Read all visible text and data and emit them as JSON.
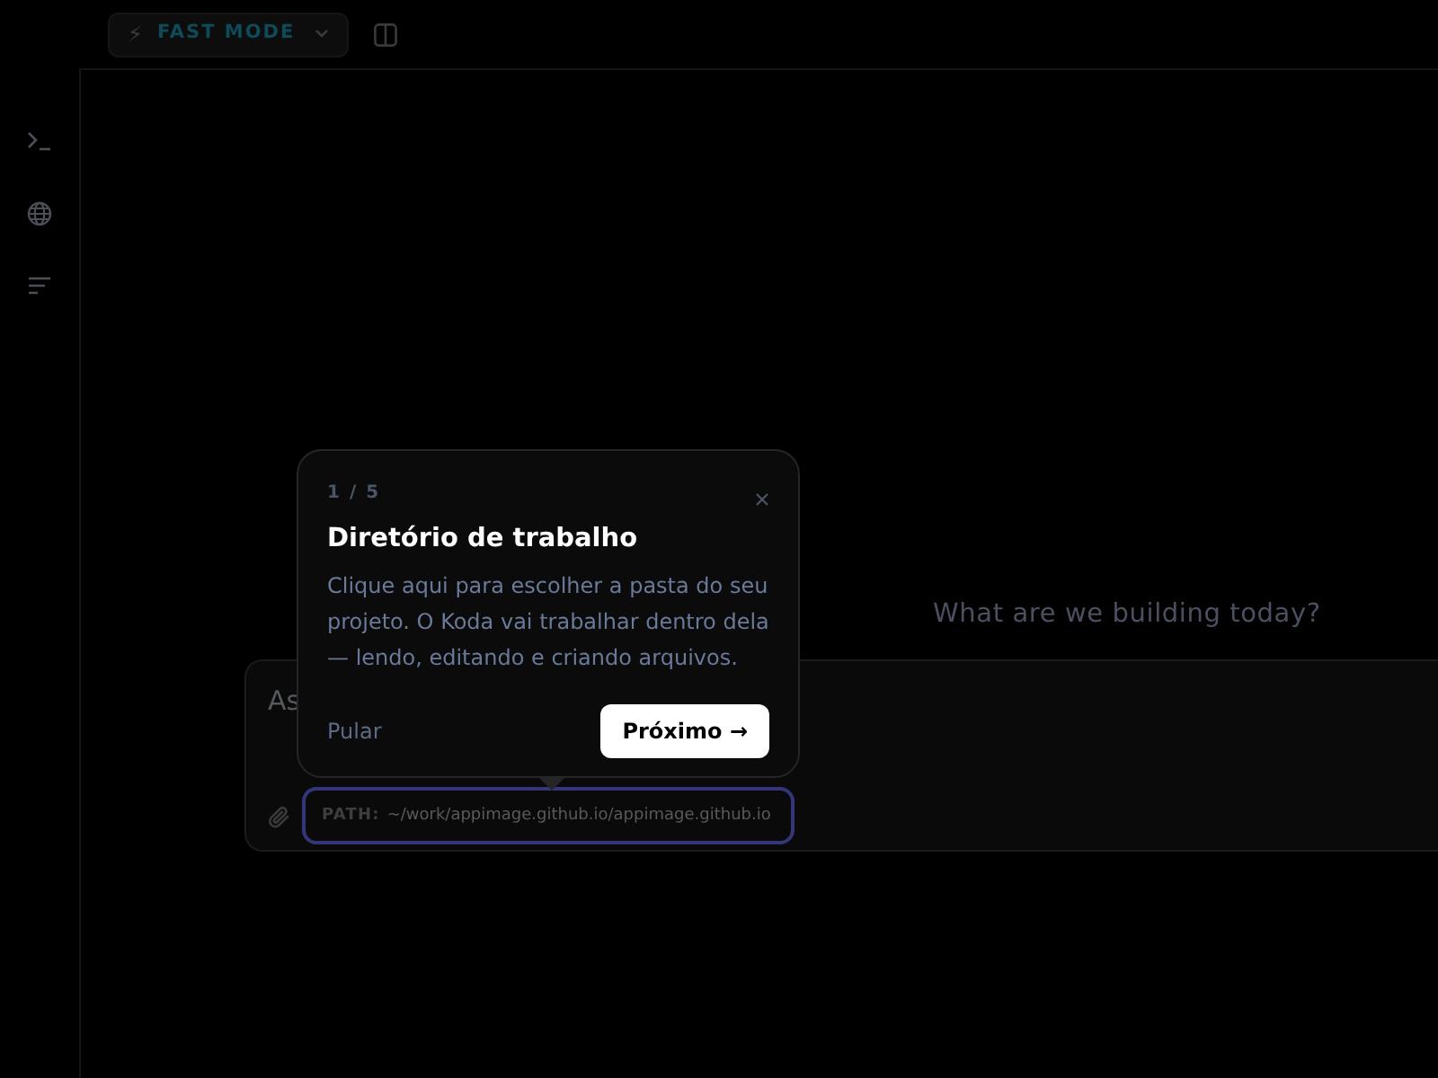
{
  "toolbar": {
    "mode_button": {
      "icon": "⚡",
      "label": "FAST MODE"
    }
  },
  "sidebar": {
    "items": [
      {
        "kind": "terminal"
      },
      {
        "kind": "globe"
      },
      {
        "kind": "list"
      }
    ]
  },
  "main": {
    "heading": "What are we building today?",
    "composer": {
      "placeholder_visible": "As",
      "path": {
        "label": "PATH:",
        "value": "~/work/appimage.github.io/appimage.github.io"
      }
    }
  },
  "tour": {
    "step": "1 / 5",
    "title": "Diretório de trabalho",
    "body": "Clique aqui para escolher a pasta do seu projeto. O Koda vai trabalhar dentro dela — lendo, editando e criando arquivos.",
    "skip": "Pular",
    "next": "Próximo →"
  }
}
